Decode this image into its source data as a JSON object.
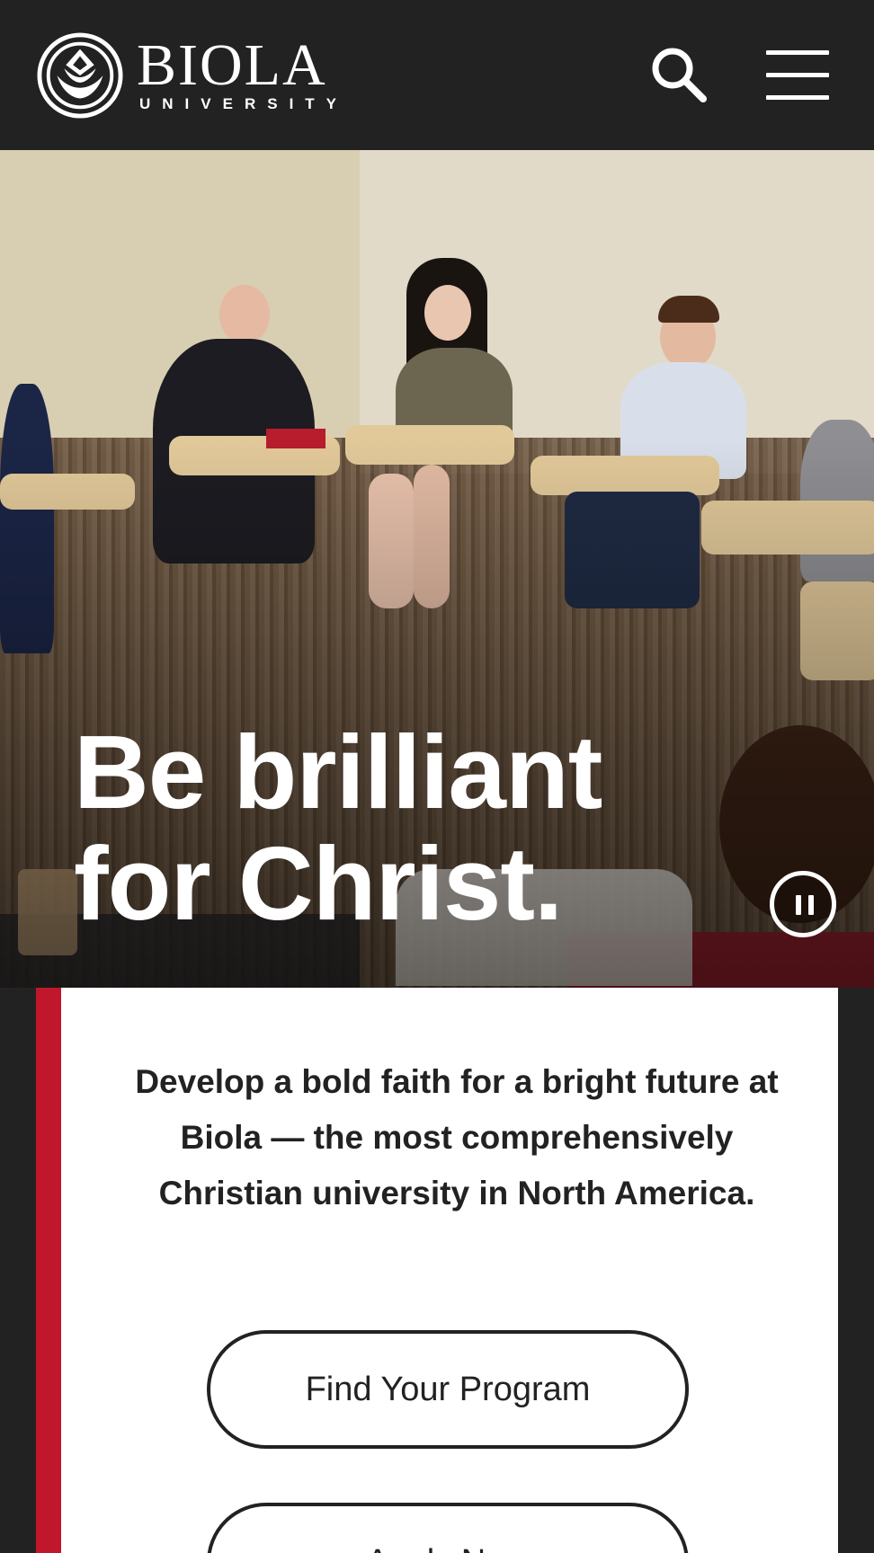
{
  "header": {
    "logo": {
      "name": "BIOLA",
      "sub": "UNIVERSITY",
      "icon": "biola-crest-icon"
    },
    "search_icon": "search-icon",
    "menu_icon": "hamburger-menu-icon"
  },
  "hero": {
    "title_line1": "Be brilliant",
    "title_line2": "for Christ.",
    "pause_icon": "pause-icon"
  },
  "intro": {
    "text": "Develop a bold faith for a bright future at Biola — the most comprehensively Christian university in North America."
  },
  "buttons": {
    "find_program": "Find Your Program",
    "apply_now": "Apply Now"
  },
  "colors": {
    "header_bg": "#222222",
    "accent": "#c0172c",
    "text": "#222222"
  }
}
